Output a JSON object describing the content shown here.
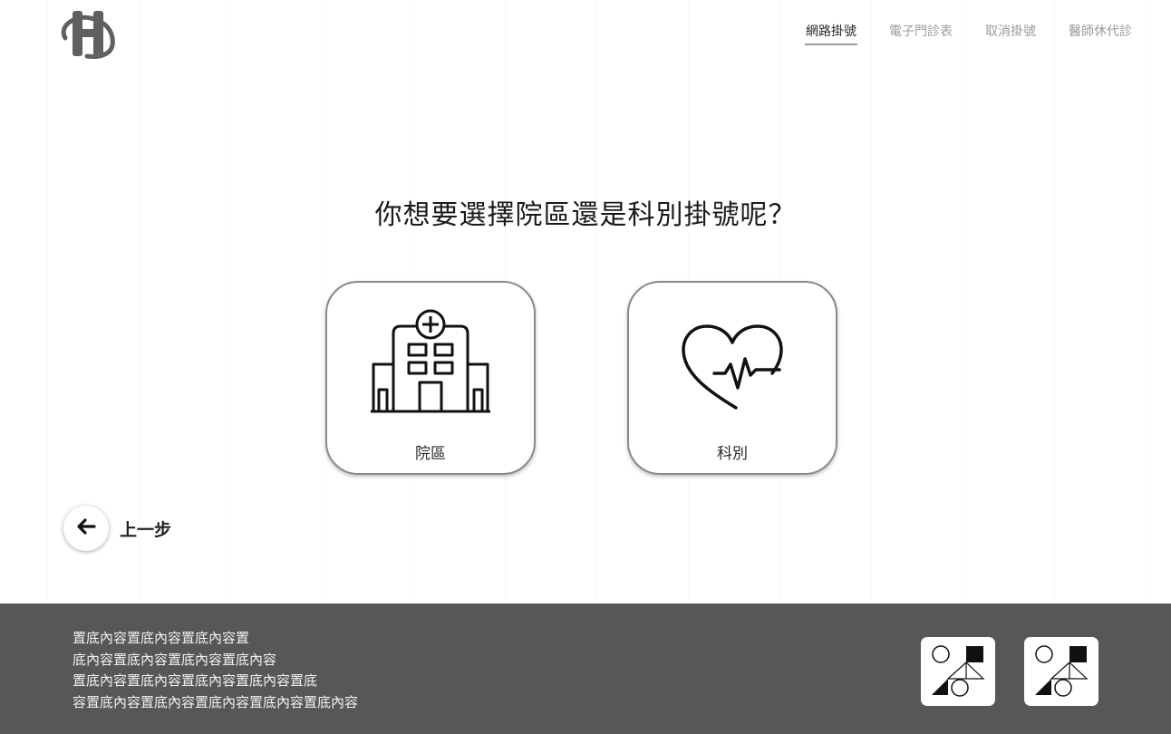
{
  "header": {
    "logo_icon": "h-logo-icon",
    "nav": [
      {
        "label": "網路掛號",
        "active": true
      },
      {
        "label": "電子門診表",
        "active": false
      },
      {
        "label": "取消掛號",
        "active": false
      },
      {
        "label": "醫師休代診",
        "active": false
      }
    ]
  },
  "main": {
    "question": "你想要選擇院區還是科別掛號呢？",
    "choices": [
      {
        "label": "院區",
        "icon": "hospital-icon"
      },
      {
        "label": "科別",
        "icon": "heartbeat-icon"
      }
    ],
    "back": {
      "label": "上一步",
      "icon": "arrow-left-icon"
    }
  },
  "footer": {
    "lines": [
      "置底內容置底內容置底內容置",
      "底內容置底內容置底內容置底內容",
      "置底內容置底內容置底內容置底內容置底",
      "容置底內容置底內容置底內容置底內容置底內容"
    ],
    "badges": [
      "shapes-icon",
      "shapes-icon"
    ]
  },
  "colors": {
    "footer_bg": "#575757",
    "nav_active": "#2a2a2a",
    "nav_inactive": "#9a9a9a",
    "card_border": "#8a8a8a"
  }
}
